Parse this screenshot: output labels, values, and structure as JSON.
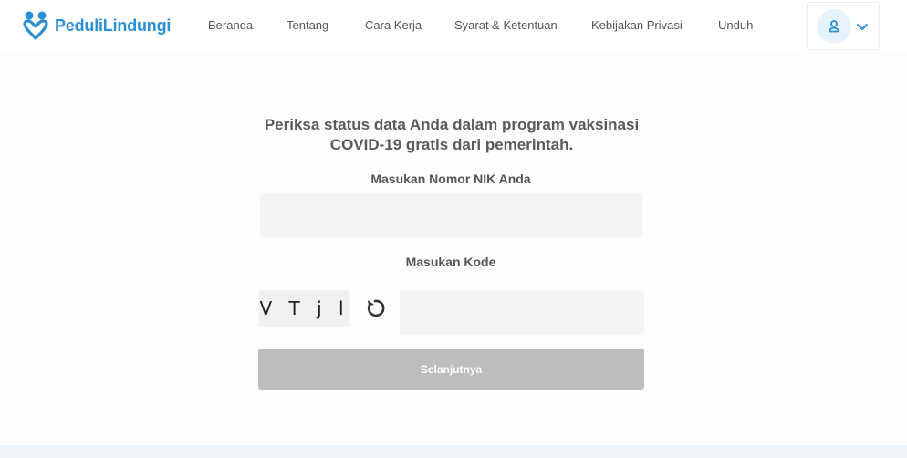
{
  "header": {
    "logo_text": "PeduliLindungi",
    "nav": [
      {
        "label": "Beranda"
      },
      {
        "label": "Tentang"
      },
      {
        "label": "Cara Kerja"
      },
      {
        "label": "Syarat & Ketentuan"
      },
      {
        "label": "Kebijakan Privasi"
      },
      {
        "label": "Unduh"
      }
    ],
    "account_icon": "user-icon",
    "dropdown_icon": "chevron-down-icon"
  },
  "main": {
    "title_line1": "Periksa status data Anda dalam program vaksinasi",
    "title_line2": "COVID-19 gratis dari pemerintah.",
    "nik_label": "Masukan Nomor NIK Anda",
    "nik_value": "",
    "code_label": "Masukan Kode",
    "captcha_text": "V T j l",
    "refresh_icon": "refresh-icon",
    "code_value": "",
    "submit_label": "Selanjutnya"
  },
  "colors": {
    "brand": "#2b8fd6",
    "button_disabled": "#bdbcbe",
    "input_bg": "#f4f3f5"
  }
}
